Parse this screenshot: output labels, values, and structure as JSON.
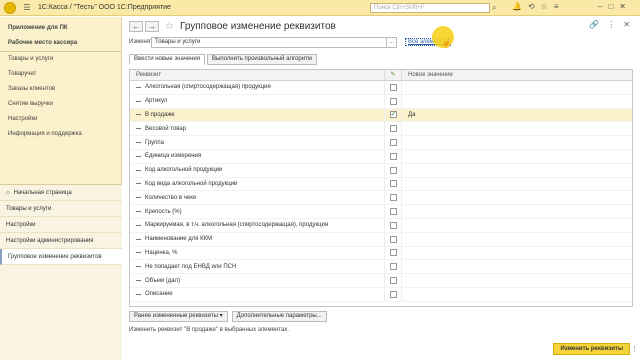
{
  "topbar": {
    "app_title": "1С:Касса / \"Тесть\" ООО 1С:Предприятие",
    "search_placeholder": "Поиск Ctrl+Shift+F"
  },
  "sidebar": {
    "top_items": [
      {
        "label": "Приложение для ПК",
        "bold": true
      },
      {
        "label": "Рабочее место кассира",
        "bold": true
      },
      {
        "label": "Товары и услуги",
        "bold": false
      },
      {
        "label": "Товаручет",
        "bold": false
      },
      {
        "label": "Заказы клиентов",
        "bold": false
      },
      {
        "label": "Снятие выручки",
        "bold": false
      },
      {
        "label": "Настройки",
        "bold": false
      },
      {
        "label": "Информация и поддержка",
        "bold": false
      }
    ],
    "nav_items": [
      {
        "label": "Начальная страница"
      },
      {
        "label": "Товары и услуги"
      },
      {
        "label": "Настройки"
      },
      {
        "label": "Настройки администрирования"
      },
      {
        "label": "Групповое изменение реквизитов"
      }
    ]
  },
  "form": {
    "title": "Групповое изменение реквизитов",
    "change_label": "Изменять:",
    "change_value": "Товары и услуги",
    "all_items_link": "Все элементы",
    "tab_new_values": "Ввести новые значения",
    "tab_algorithm": "Выполнить произвольный алгоритм",
    "col_requisite": "Реквизит",
    "col_new_value": "Новое значение",
    "rows": [
      {
        "name": "Алкогольная (спиртосодержащая) продукция",
        "checked": false,
        "value": ""
      },
      {
        "name": "Артикул",
        "checked": false,
        "value": ""
      },
      {
        "name": "В продаже",
        "checked": true,
        "value": "Да"
      },
      {
        "name": "Весовой товар",
        "checked": false,
        "value": ""
      },
      {
        "name": "Группа",
        "checked": false,
        "value": ""
      },
      {
        "name": "Единица измерения",
        "checked": false,
        "value": ""
      },
      {
        "name": "Код алкогольной продукции",
        "checked": false,
        "value": ""
      },
      {
        "name": "Код вида алкогольной продукции",
        "checked": false,
        "value": ""
      },
      {
        "name": "Количество в чеке",
        "checked": false,
        "value": ""
      },
      {
        "name": "Крепость (%)",
        "checked": false,
        "value": ""
      },
      {
        "name": "Маркируемая, в т.ч. алкогольная (спиртосодержащая), продукция",
        "checked": false,
        "value": ""
      },
      {
        "name": "Наименование для ККМ",
        "checked": false,
        "value": ""
      },
      {
        "name": "Наценка, %",
        "checked": false,
        "value": ""
      },
      {
        "name": "Не попадает под ЕНВД или ПСН",
        "checked": false,
        "value": ""
      },
      {
        "name": "Объем (дал)",
        "checked": false,
        "value": ""
      },
      {
        "name": "Описание",
        "checked": false,
        "value": ""
      }
    ],
    "btn_prev_changed": "Ранее измененные реквизиты",
    "btn_extra_params": "Дополнительные параметры...",
    "status_text": "Изменить реквизит \"В продаже\" в выбранных элементах.",
    "btn_apply": "Изменить реквизиты"
  }
}
